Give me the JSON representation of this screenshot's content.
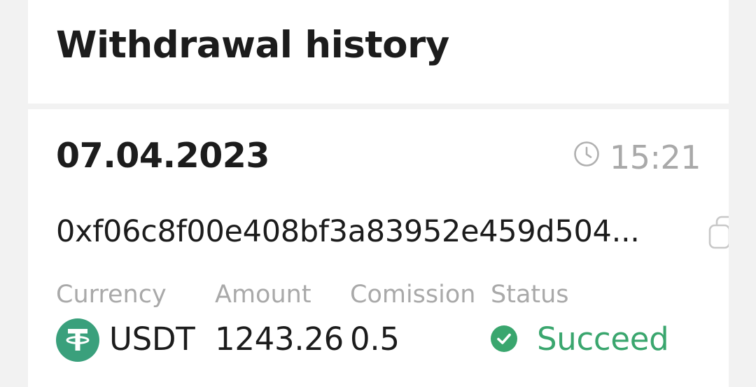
{
  "header": {
    "title": "Withdrawal history"
  },
  "transaction": {
    "date": "07.04.2023",
    "time": "15:21",
    "address": "0xf06c8f00e408bf3a83952e459d504...",
    "columns": {
      "currency_label": "Currency",
      "amount_label": "Amount",
      "commission_label": "Comission",
      "status_label": "Status"
    },
    "currency": "USDT",
    "amount": "1243.26",
    "commission": "0.5",
    "status": "Succeed"
  },
  "colors": {
    "status_success": "#3aa66e",
    "tether_green": "#3aa07c",
    "muted_text": "#a9a9a9"
  },
  "icons": {
    "time": "clock-icon",
    "copy": "copy-icon",
    "currency": "tether-icon",
    "status": "check-circle-icon"
  }
}
